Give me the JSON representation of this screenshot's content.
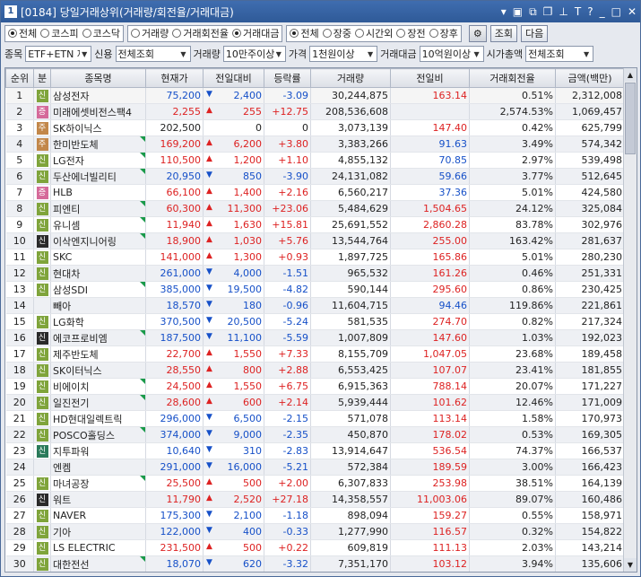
{
  "window": {
    "number": "1",
    "title": "[0184] 당일거래상위(거래량/회전율/거래대금)"
  },
  "market": {
    "options": [
      "전체",
      "코스피",
      "코스닥"
    ],
    "selected": 0
  },
  "sort": {
    "options": [
      "거래량",
      "거래회전율",
      "거래대금"
    ],
    "selected": 2
  },
  "session": {
    "options": [
      "전체",
      "장중",
      "시간외",
      "장전",
      "장후"
    ],
    "selected": 0
  },
  "buttons": {
    "query": "조회",
    "next": "다음"
  },
  "filters": {
    "item_label": "종목",
    "item_value": "ETF+ETN 제",
    "credit_label": "신용",
    "credit_value": "전체조회",
    "volume_label": "거래량",
    "volume_value": "10만주이상",
    "price_label": "가격",
    "price_value": "1천원이상",
    "amount_label": "거래대금",
    "amount_value": "10억원이상",
    "cap_label": "시가총액",
    "cap_value": "전체조회"
  },
  "colors": {
    "up": "#dd2222",
    "down": "#1650c8"
  },
  "table": {
    "headers": [
      "순위",
      "분",
      "종목명",
      "현재가",
      "전일대비",
      "등락률",
      "거래량",
      "전일비",
      "거래회전율",
      "금액(백만)"
    ],
    "rows": [
      {
        "rank": "1",
        "badge": "신",
        "bt": "sin",
        "name": "삼성전자",
        "price": "75,200",
        "dir": "dn",
        "chg": "2,400",
        "rate": "-3.09",
        "vol": "30,244,875",
        "prev": "163.14",
        "prevdir": "up",
        "turn": "0.51%",
        "amt": "2,312,008",
        "flag": false
      },
      {
        "rank": "2",
        "badge": "증",
        "bt": "jeung",
        "name": "미래에셋비전스팩4",
        "price": "2,255",
        "dir": "up",
        "chg": "255",
        "rate": "+12.75",
        "vol": "208,536,608",
        "prev": "",
        "prevdir": "",
        "turn": "2,574.53%",
        "amt": "1,069,457",
        "flag": false
      },
      {
        "rank": "3",
        "badge": "주",
        "bt": "ju",
        "name": "SK하이닉스",
        "price": "202,500",
        "dir": "",
        "chg": "0",
        "rate": "0",
        "vol": "3,073,139",
        "prev": "147.40",
        "prevdir": "up",
        "turn": "0.42%",
        "amt": "625,799",
        "flag": false
      },
      {
        "rank": "4",
        "badge": "주",
        "bt": "ju",
        "name": "한미반도체",
        "price": "169,200",
        "dir": "up",
        "chg": "6,200",
        "rate": "+3.80",
        "vol": "3,383,266",
        "prev": "91.63",
        "prevdir": "dn",
        "turn": "3.49%",
        "amt": "574,342",
        "flag": true
      },
      {
        "rank": "5",
        "badge": "신",
        "bt": "sin",
        "name": "LG전자",
        "price": "110,500",
        "dir": "up",
        "chg": "1,200",
        "rate": "+1.10",
        "vol": "4,855,132",
        "prev": "70.85",
        "prevdir": "dn",
        "turn": "2.97%",
        "amt": "539,498",
        "flag": true
      },
      {
        "rank": "6",
        "badge": "신",
        "bt": "sin",
        "name": "두산에너빌리티",
        "price": "20,950",
        "dir": "dn",
        "chg": "850",
        "rate": "-3.90",
        "vol": "24,131,082",
        "prev": "59.66",
        "prevdir": "dn",
        "turn": "3.77%",
        "amt": "512,645",
        "flag": true
      },
      {
        "rank": "7",
        "badge": "증",
        "bt": "jeung",
        "name": "HLB",
        "price": "66,100",
        "dir": "up",
        "chg": "1,400",
        "rate": "+2.16",
        "vol": "6,560,217",
        "prev": "37.36",
        "prevdir": "dn",
        "turn": "5.01%",
        "amt": "424,580",
        "flag": false
      },
      {
        "rank": "8",
        "badge": "신",
        "bt": "sin",
        "name": "피엔티",
        "price": "60,300",
        "dir": "up",
        "chg": "11,300",
        "rate": "+23.06",
        "vol": "5,484,629",
        "prev": "1,504.65",
        "prevdir": "up",
        "turn": "24.12%",
        "amt": "325,084",
        "flag": true
      },
      {
        "rank": "9",
        "badge": "신",
        "bt": "sin",
        "name": "유니셈",
        "price": "11,940",
        "dir": "up",
        "chg": "1,630",
        "rate": "+15.81",
        "vol": "25,691,552",
        "prev": "2,860.28",
        "prevdir": "up",
        "turn": "83.78%",
        "amt": "302,976",
        "flag": true
      },
      {
        "rank": "10",
        "badge": "신",
        "bt": "new",
        "name": "이삭엔지니어링",
        "price": "18,900",
        "dir": "up",
        "chg": "1,030",
        "rate": "+5.76",
        "vol": "13,544,764",
        "prev": "255.00",
        "prevdir": "up",
        "turn": "163.42%",
        "amt": "281,637",
        "flag": true
      },
      {
        "rank": "11",
        "badge": "신",
        "bt": "sin",
        "name": "SKC",
        "price": "141,000",
        "dir": "up",
        "chg": "1,300",
        "rate": "+0.93",
        "vol": "1,897,725",
        "prev": "165.86",
        "prevdir": "up",
        "turn": "5.01%",
        "amt": "280,230",
        "flag": false
      },
      {
        "rank": "12",
        "badge": "신",
        "bt": "sin",
        "name": "현대차",
        "price": "261,000",
        "dir": "dn",
        "chg": "4,000",
        "rate": "-1.51",
        "vol": "965,532",
        "prev": "161.26",
        "prevdir": "up",
        "turn": "0.46%",
        "amt": "251,331",
        "flag": false
      },
      {
        "rank": "13",
        "badge": "신",
        "bt": "sin",
        "name": "삼성SDI",
        "price": "385,000",
        "dir": "dn",
        "chg": "19,500",
        "rate": "-4.82",
        "vol": "590,144",
        "prev": "295.60",
        "prevdir": "up",
        "turn": "0.86%",
        "amt": "230,425",
        "flag": true
      },
      {
        "rank": "14",
        "badge": "",
        "bt": "",
        "name": "빼아",
        "price": "18,570",
        "dir": "dn",
        "chg": "180",
        "rate": "-0.96",
        "vol": "11,604,715",
        "prev": "94.46",
        "prevdir": "dn",
        "turn": "119.86%",
        "amt": "221,861",
        "flag": false
      },
      {
        "rank": "15",
        "badge": "신",
        "bt": "sin",
        "name": "LG화학",
        "price": "370,500",
        "dir": "dn",
        "chg": "20,500",
        "rate": "-5.24",
        "vol": "581,535",
        "prev": "274.70",
        "prevdir": "up",
        "turn": "0.82%",
        "amt": "217,324",
        "flag": false
      },
      {
        "rank": "16",
        "badge": "신",
        "bt": "new",
        "name": "에코프로비엠",
        "price": "187,500",
        "dir": "dn",
        "chg": "11,100",
        "rate": "-5.59",
        "vol": "1,007,809",
        "prev": "147.60",
        "prevdir": "up",
        "turn": "1.03%",
        "amt": "192,023",
        "flag": true
      },
      {
        "rank": "17",
        "badge": "신",
        "bt": "sin",
        "name": "제주반도체",
        "price": "22,700",
        "dir": "up",
        "chg": "1,550",
        "rate": "+7.33",
        "vol": "8,155,709",
        "prev": "1,047.05",
        "prevdir": "up",
        "turn": "23.68%",
        "amt": "189,458",
        "flag": false
      },
      {
        "rank": "18",
        "badge": "신",
        "bt": "sin",
        "name": "SK이터닉스",
        "price": "28,550",
        "dir": "up",
        "chg": "800",
        "rate": "+2.88",
        "vol": "6,553,425",
        "prev": "107.07",
        "prevdir": "up",
        "turn": "23.41%",
        "amt": "181,855",
        "flag": false
      },
      {
        "rank": "19",
        "badge": "신",
        "bt": "sin",
        "name": "비에이치",
        "price": "24,500",
        "dir": "up",
        "chg": "1,550",
        "rate": "+6.75",
        "vol": "6,915,363",
        "prev": "788.14",
        "prevdir": "up",
        "turn": "20.07%",
        "amt": "171,227",
        "flag": true
      },
      {
        "rank": "20",
        "badge": "신",
        "bt": "sin",
        "name": "일진전기",
        "price": "28,600",
        "dir": "up",
        "chg": "600",
        "rate": "+2.14",
        "vol": "5,939,444",
        "prev": "101.62",
        "prevdir": "up",
        "turn": "12.46%",
        "amt": "171,009",
        "flag": true
      },
      {
        "rank": "21",
        "badge": "신",
        "bt": "sin",
        "name": "HD현대일렉트릭",
        "price": "296,000",
        "dir": "dn",
        "chg": "6,500",
        "rate": "-2.15",
        "vol": "571,078",
        "prev": "113.14",
        "prevdir": "up",
        "turn": "1.58%",
        "amt": "170,973",
        "flag": false
      },
      {
        "rank": "22",
        "badge": "신",
        "bt": "sin",
        "name": "POSCO홀딩스",
        "price": "374,000",
        "dir": "dn",
        "chg": "9,000",
        "rate": "-2.35",
        "vol": "450,870",
        "prev": "178.02",
        "prevdir": "up",
        "turn": "0.53%",
        "amt": "169,305",
        "flag": true
      },
      {
        "rank": "23",
        "badge": "신",
        "bt": "ban",
        "name": "지투파워",
        "price": "10,640",
        "dir": "dn",
        "chg": "310",
        "rate": "-2.83",
        "vol": "13,914,647",
        "prev": "536.54",
        "prevdir": "up",
        "turn": "74.37%",
        "amt": "166,537",
        "flag": false
      },
      {
        "rank": "24",
        "badge": "",
        "bt": "",
        "name": "엔켐",
        "price": "291,000",
        "dir": "dn",
        "chg": "16,000",
        "rate": "-5.21",
        "vol": "572,384",
        "prev": "189.59",
        "prevdir": "up",
        "turn": "3.00%",
        "amt": "166,423",
        "flag": false
      },
      {
        "rank": "25",
        "badge": "신",
        "bt": "sin",
        "name": "마녀공장",
        "price": "25,500",
        "dir": "up",
        "chg": "500",
        "rate": "+2.00",
        "vol": "6,307,833",
        "prev": "253.98",
        "prevdir": "up",
        "turn": "38.51%",
        "amt": "164,139",
        "flag": true
      },
      {
        "rank": "26",
        "badge": "신",
        "bt": "new",
        "name": "워트",
        "price": "11,790",
        "dir": "up",
        "chg": "2,520",
        "rate": "+27.18",
        "vol": "14,358,557",
        "prev": "11,003.06",
        "prevdir": "up",
        "turn": "89.07%",
        "amt": "160,486",
        "flag": false
      },
      {
        "rank": "27",
        "badge": "신",
        "bt": "sin",
        "name": "NAVER",
        "price": "175,300",
        "dir": "dn",
        "chg": "2,100",
        "rate": "-1.18",
        "vol": "898,094",
        "prev": "159.27",
        "prevdir": "up",
        "turn": "0.55%",
        "amt": "158,971",
        "flag": false
      },
      {
        "rank": "28",
        "badge": "신",
        "bt": "sin",
        "name": "기아",
        "price": "122,000",
        "dir": "dn",
        "chg": "400",
        "rate": "-0.33",
        "vol": "1,277,990",
        "prev": "116.57",
        "prevdir": "up",
        "turn": "0.32%",
        "amt": "154,822",
        "flag": false
      },
      {
        "rank": "29",
        "badge": "신",
        "bt": "sin",
        "name": "LS ELECTRIC",
        "price": "231,500",
        "dir": "up",
        "chg": "500",
        "rate": "+0.22",
        "vol": "609,819",
        "prev": "111.13",
        "prevdir": "up",
        "turn": "2.03%",
        "amt": "143,214",
        "flag": false
      },
      {
        "rank": "30",
        "badge": "신",
        "bt": "sin",
        "name": "대한전선",
        "price": "18,070",
        "dir": "dn",
        "chg": "620",
        "rate": "-3.32",
        "vol": "7,351,170",
        "prev": "103.12",
        "prevdir": "up",
        "turn": "3.94%",
        "amt": "135,606",
        "flag": true
      }
    ]
  }
}
